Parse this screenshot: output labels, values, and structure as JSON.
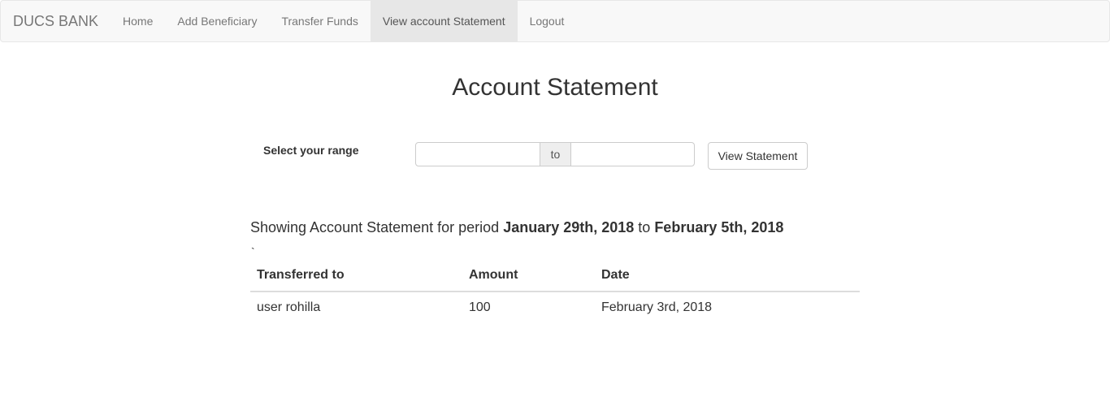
{
  "navbar": {
    "brand": "DUCS BANK",
    "items": [
      {
        "label": "Home",
        "active": false
      },
      {
        "label": "Add Beneficiary",
        "active": false
      },
      {
        "label": "Transfer Funds",
        "active": false
      },
      {
        "label": "View account Statement",
        "active": true
      },
      {
        "label": "Logout",
        "active": false
      }
    ]
  },
  "page": {
    "title": "Account Statement"
  },
  "range_form": {
    "label": "Select your range",
    "from_value": "",
    "separator": "to",
    "to_value": "",
    "submit_label": "View Statement"
  },
  "summary": {
    "prefix": "Showing Account Statement for period ",
    "start_date": "January 29th, 2018",
    "middle": " to ",
    "end_date": "February 5th, 2018",
    "stray_mark": "`"
  },
  "table": {
    "headers": [
      "Transferred to",
      "Amount",
      "Date"
    ],
    "rows": [
      [
        "user rohilla",
        "100",
        "February 3rd, 2018"
      ]
    ]
  }
}
